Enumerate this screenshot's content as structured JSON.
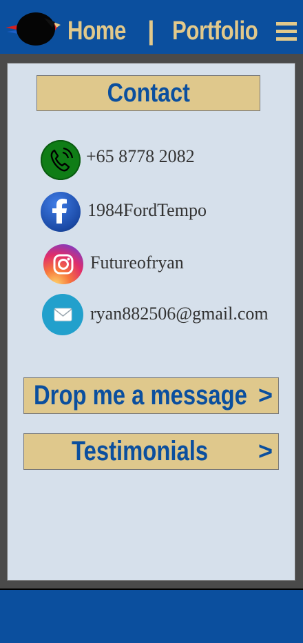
{
  "nav": {
    "home": "Home",
    "separator": "|",
    "portfolio": "Portfolio",
    "logo_icon": "eagle-logo-icon",
    "menu_icon": "hamburger-menu-icon"
  },
  "contact": {
    "heading": "Contact",
    "items": [
      {
        "icon": "phone-icon",
        "text": "+65 8778 2082"
      },
      {
        "icon": "facebook-icon",
        "text": "1984FordTempo"
      },
      {
        "icon": "instagram-icon",
        "text": "Futureofryan"
      },
      {
        "icon": "email-icon",
        "text": "ryan882506@gmail.com"
      }
    ]
  },
  "actions": {
    "message": "Drop me a message",
    "message_arrow": ">",
    "testimonials": "Testimonials",
    "testimonials_arrow": ">"
  },
  "colors": {
    "brand_blue": "#0b4f9e",
    "gold": "#dfc88c",
    "panel_bg": "#d6e0eb",
    "frame_gray": "#4a4a4a"
  }
}
